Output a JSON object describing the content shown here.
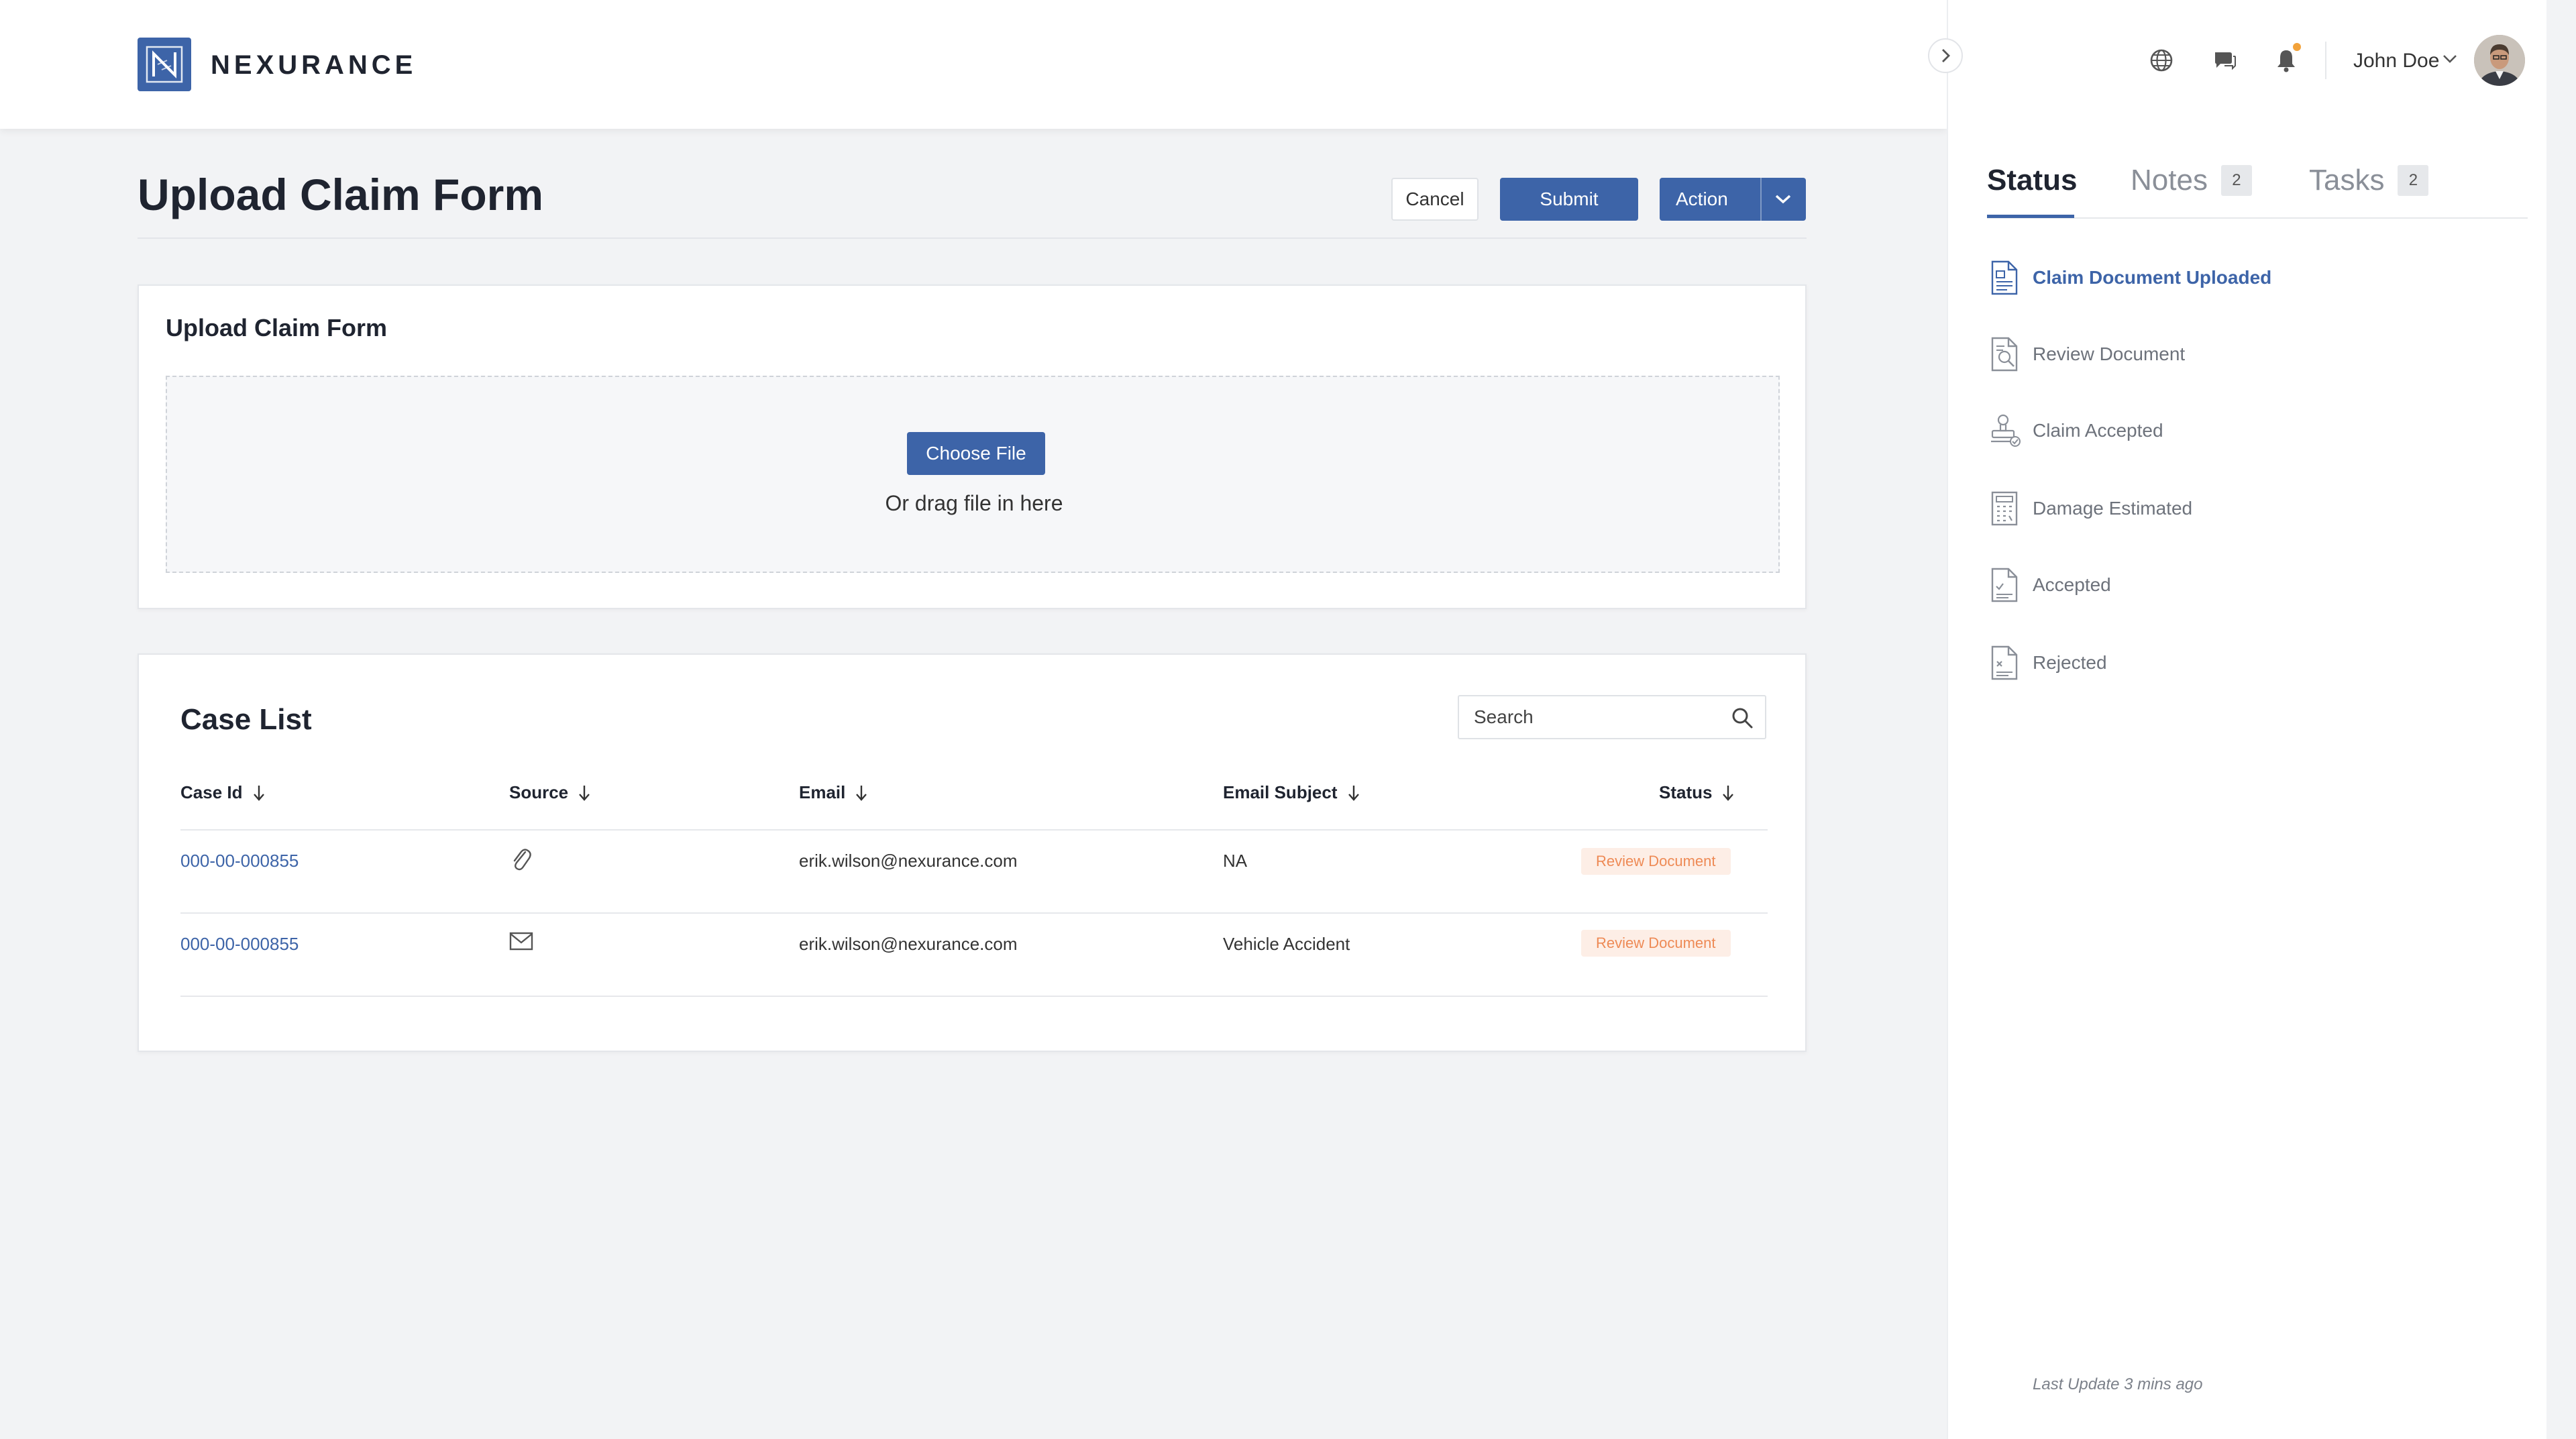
{
  "brand": {
    "name": "NEXURANCE"
  },
  "header": {
    "title": "Upload Claim Form",
    "cancel_label": "Cancel",
    "submit_label": "Submit",
    "action_label": "Action"
  },
  "upload": {
    "title": "Upload Claim Form",
    "choose_file_label": "Choose File",
    "drag_text": "Or drag file in here"
  },
  "case_list": {
    "title": "Case List",
    "search_placeholder": "Search",
    "columns": [
      "Case Id",
      "Source",
      "Email",
      "Email Subject",
      "Status"
    ],
    "rows": [
      {
        "case_id": "000-00-000855",
        "source_icon": "paperclip-icon",
        "email": "erik.wilson@nexurance.com",
        "subject": "NA",
        "status": "Review Document"
      },
      {
        "case_id": "000-00-000855",
        "source_icon": "envelope-icon",
        "email": "erik.wilson@nexurance.com",
        "subject": "Vehicle Accident",
        "status": "Review Document"
      }
    ]
  },
  "user": {
    "name": "John Doe"
  },
  "topbar_icons": [
    "globe-icon",
    "chat-icon",
    "bell-icon"
  ],
  "side_panel": {
    "tabs": [
      {
        "label": "Status",
        "count": ""
      },
      {
        "label": "Notes",
        "count": "2"
      },
      {
        "label": "Tasks",
        "count": "2"
      }
    ],
    "status_items": [
      {
        "label": "Claim Document Uploaded",
        "icon": "document-upload-icon",
        "current": true
      },
      {
        "label": "Review Document",
        "icon": "document-review-icon",
        "current": false
      },
      {
        "label": "Claim Accepted",
        "icon": "stamp-icon",
        "current": false
      },
      {
        "label": "Damage Estimated",
        "icon": "calculator-icon",
        "current": false
      },
      {
        "label": "Accepted",
        "icon": "document-check-icon",
        "current": false
      },
      {
        "label": "Rejected",
        "icon": "document-x-icon",
        "current": false
      }
    ],
    "last_update": "Last Update 3 mins ago"
  },
  "colors": {
    "primary": "#3d64a8",
    "badge_bg": "#fdeee6",
    "badge_text": "#ee8a55",
    "notification_dot": "#f2a23a",
    "page_bg": "#f2f3f5"
  }
}
